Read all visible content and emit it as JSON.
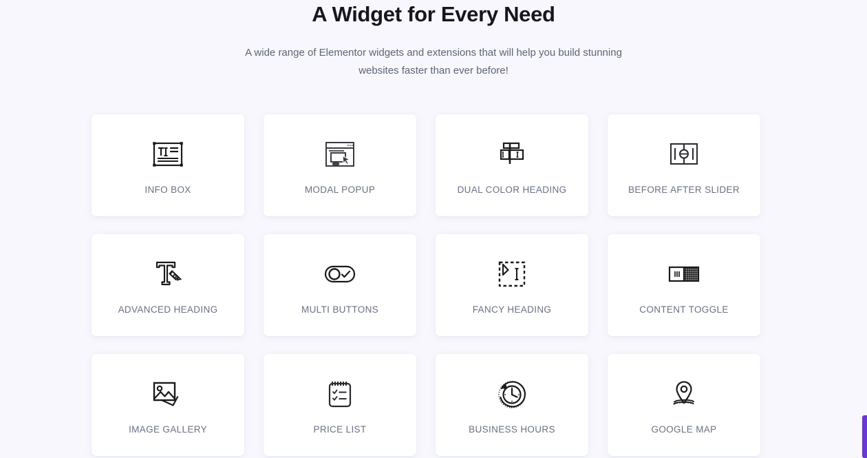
{
  "header": {
    "title": "A Widget for Every Need",
    "subtitle": "A wide range of Elementor widgets and extensions that will help you build stunning websites faster than ever before!"
  },
  "colors": {
    "page_background": "#f7f7fd",
    "card_background": "#ffffff",
    "title_text": "#16171c",
    "subtitle_text": "#5f6474",
    "label_text": "#6a7085",
    "icon_stroke": "#1a1a1a",
    "accent": "#6c35de"
  },
  "grid": {
    "columns": 4,
    "rows": 3,
    "cards": [
      {
        "label": "INFO BOX",
        "icon": "info-box-icon"
      },
      {
        "label": "MODAL POPUP",
        "icon": "modal-popup-icon"
      },
      {
        "label": "DUAL COLOR HEADING",
        "icon": "dual-color-heading-icon"
      },
      {
        "label": "BEFORE AFTER SLIDER",
        "icon": "before-after-slider-icon"
      },
      {
        "label": "ADVANCED HEADING",
        "icon": "advanced-heading-icon"
      },
      {
        "label": "MULTI BUTTONS",
        "icon": "multi-buttons-icon"
      },
      {
        "label": "FANCY HEADING",
        "icon": "fancy-heading-icon"
      },
      {
        "label": "CONTENT TOGGLE",
        "icon": "content-toggle-icon"
      },
      {
        "label": "IMAGE GALLERY",
        "icon": "image-gallery-icon"
      },
      {
        "label": "PRICE LIST",
        "icon": "price-list-icon"
      },
      {
        "label": "BUSINESS HOURS",
        "icon": "business-hours-icon"
      },
      {
        "label": "GOOGLE MAP",
        "icon": "google-map-icon"
      }
    ]
  }
}
